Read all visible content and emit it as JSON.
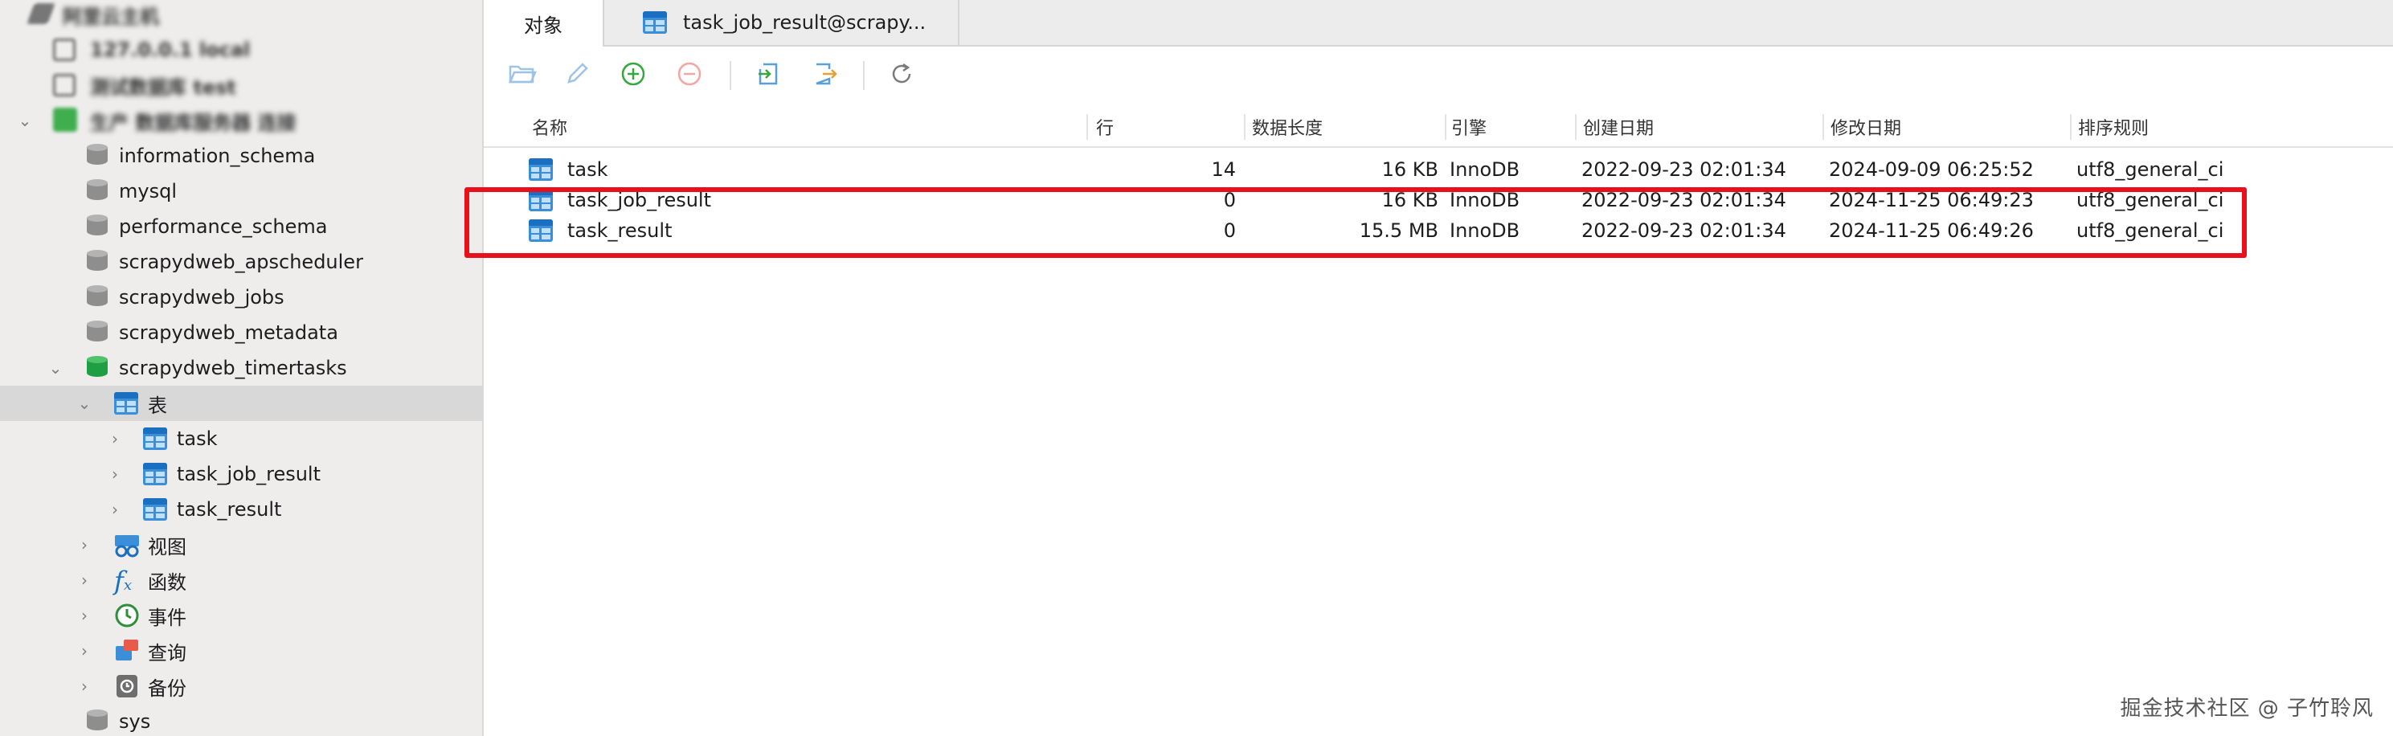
{
  "sidebar": {
    "connections": [
      {
        "label": "阿里云主机"
      },
      {
        "label": "127.0.0.1 local"
      },
      {
        "label": "测试数据库 test"
      },
      {
        "label": "生产 数据库服务器 连接"
      }
    ],
    "databases": [
      {
        "label": "information_schema"
      },
      {
        "label": "mysql"
      },
      {
        "label": "performance_schema"
      },
      {
        "label": "scrapydweb_apscheduler"
      },
      {
        "label": "scrapydweb_jobs"
      },
      {
        "label": "scrapydweb_metadata"
      },
      {
        "label": "scrapydweb_timertasks"
      }
    ],
    "tables_folder": "表",
    "tables": [
      {
        "label": "task"
      },
      {
        "label": "task_job_result"
      },
      {
        "label": "task_result"
      }
    ],
    "groups": [
      {
        "label": "视图",
        "icon": "view-icon"
      },
      {
        "label": "函数",
        "icon": "function-icon"
      },
      {
        "label": "事件",
        "icon": "event-icon"
      },
      {
        "label": "查询",
        "icon": "query-icon"
      },
      {
        "label": "备份",
        "icon": "backup-icon"
      }
    ],
    "sys": "sys"
  },
  "tabs": [
    {
      "label": "对象",
      "active": true
    },
    {
      "label": "task_job_result@scrapy...",
      "active": false
    }
  ],
  "toolbar": {
    "buttons": [
      "open-table-icon",
      "design-table-icon",
      "new-table-icon",
      "delete-table-icon",
      "import-icon",
      "export-icon",
      "refresh-icon"
    ]
  },
  "columns": {
    "name": "名称",
    "rows": "行",
    "data_length": "数据长度",
    "engine": "引擎",
    "created": "创建日期",
    "modified": "修改日期",
    "collation": "排序规则"
  },
  "table_rows": [
    {
      "name": "task",
      "rows": "14",
      "data_length": "16 KB",
      "engine": "InnoDB",
      "created": "2022-09-23 02:01:34",
      "modified": "2024-09-09 06:25:52",
      "collation": "utf8_general_ci"
    },
    {
      "name": "task_job_result",
      "rows": "0",
      "data_length": "16 KB",
      "engine": "InnoDB",
      "created": "2022-09-23 02:01:34",
      "modified": "2024-11-25 06:49:23",
      "collation": "utf8_general_ci"
    },
    {
      "name": "task_result",
      "rows": "0",
      "data_length": "15.5 MB",
      "engine": "InnoDB",
      "created": "2022-09-23 02:01:34",
      "modified": "2024-11-25 06:49:26",
      "collation": "utf8_general_ci"
    }
  ],
  "colors": {
    "highlight": "#e8101c",
    "active_db": "#2aa84a",
    "inactive_db": "#8e8e8e",
    "table_icon": "#3b8fd9"
  },
  "watermark": "掘金技术社区 @ 子竹聆风"
}
